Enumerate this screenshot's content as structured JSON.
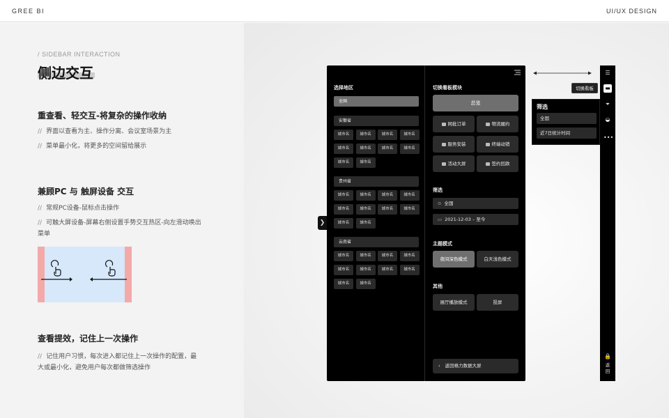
{
  "header": {
    "brand": "GREE  BI",
    "tag": "UI/UX  DESIGN"
  },
  "intro": {
    "eyebrow": "/ SIDEBAR INTERACTION",
    "title": "侧边交互"
  },
  "sections": [
    {
      "heading": "重查看、轻交互-将复杂的操作收纳",
      "points": [
        "界面以查看为主、操作分离、会议室场景为主",
        "菜单最小化，将更多的空间留给展示"
      ]
    },
    {
      "heading": "兼顾PC 与 触屏设备 交互",
      "points": [
        "常规PC设备-鼠标点击操作",
        "可触大屏设备-屏幕右侧设置手势交互热区-向左滑动唤出",
        "菜单"
      ]
    },
    {
      "heading": "查看提效，记住上一次操作",
      "points": [
        "记住用户习惯，每次进入都记住上一次操作的配置，最",
        "大或最小化，避免用户每次都做筛选操作"
      ]
    }
  ],
  "slash": "//",
  "app": {
    "handle": "❯",
    "region": {
      "label": "选择地区",
      "all": "全国",
      "provinces": [
        {
          "name": "安徽省",
          "cities": [
            "城市名",
            "城市名",
            "城市名",
            "城市名",
            "城市名",
            "城市名",
            "城市名",
            "城市名",
            "城市名",
            "城市名"
          ]
        },
        {
          "name": "贵州省",
          "cities": [
            "城市名",
            "城市名",
            "城市名",
            "城市名",
            "城市名",
            "城市名",
            "城市名",
            "城市名",
            "城市名",
            "城市名"
          ]
        },
        {
          "name": "云南省",
          "cities": [
            "城市名",
            "城市名",
            "城市名",
            "城市名",
            "城市名",
            "城市名",
            "城市名",
            "城市名",
            "城市名",
            "城市名"
          ]
        }
      ]
    },
    "board": {
      "label": "切换看板模块",
      "overview": "总览",
      "modules": [
        "网批订单",
        "物流履约",
        "服务安装",
        "终端动销",
        "活动大屏",
        "签约回款"
      ]
    },
    "filter": {
      "label": "筛选",
      "region": "全国",
      "date_from": "2021-12-03",
      "date_sep": "–",
      "date_to": "至今"
    },
    "theme": {
      "label": "主题模式",
      "dark": "夜间深色模式",
      "light": "白天浅色模式"
    },
    "other": {
      "label": "其他",
      "hall": "展厅播放模式",
      "cast": "投屏"
    },
    "back": "返回格力数据大屏"
  },
  "rail": {
    "tooltip": "切换看板",
    "back_chars": [
      "返",
      "回"
    ],
    "icons": [
      "menu-icon",
      "dashboard-icon",
      "filter-icon",
      "theme-icon",
      "more-icon",
      "lock-icon"
    ]
  },
  "popup": {
    "title": "筛选",
    "region": "全国",
    "period": "近7日统计时间"
  }
}
